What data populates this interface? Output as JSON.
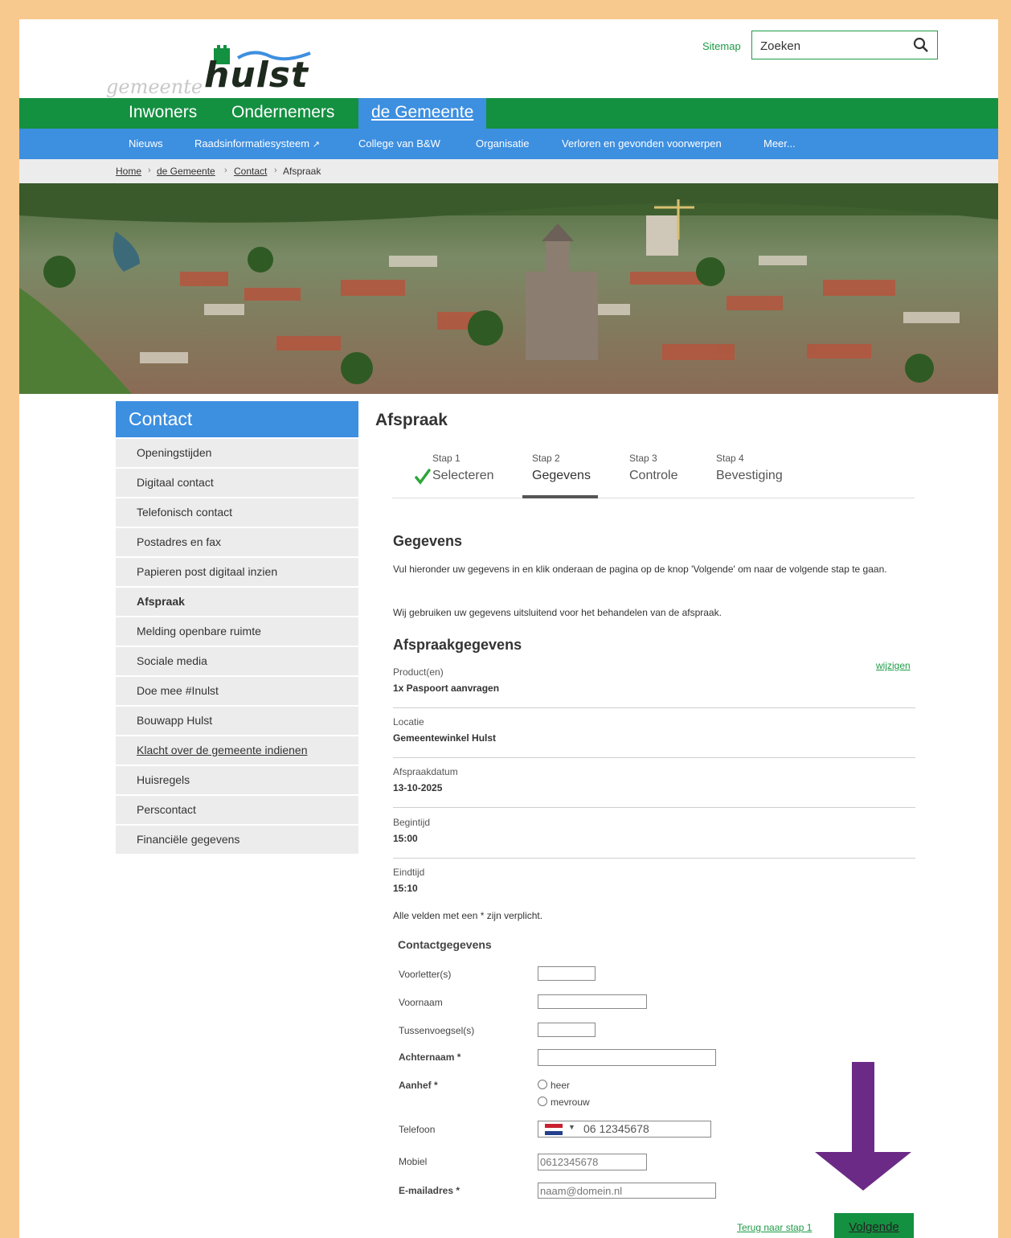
{
  "header": {
    "logo_prefix": "gemeente",
    "logo_name": "hulst",
    "sitemap_label": "Sitemap",
    "search_placeholder": "Zoeken"
  },
  "main_nav": [
    "Inwoners",
    "Ondernemers",
    "de Gemeente"
  ],
  "sub_nav": [
    "Nieuws",
    "Raadsinformatiesysteem",
    "College van B&W",
    "Organisatie",
    "Verloren en gevonden voorwerpen",
    "Meer..."
  ],
  "breadcrumb": [
    "Home",
    "de Gemeente",
    "Contact",
    "Afspraak"
  ],
  "banner_alt": "",
  "sidebar": {
    "title": "Contact",
    "items": [
      "Openingstijden",
      "Digitaal contact",
      "Telefonisch contact",
      "Postadres en fax",
      "Papieren post digitaal inzien",
      "Afspraak",
      "Melding openbare ruimte",
      "Sociale media",
      "Doe mee #Inulst",
      "Bouwapp Hulst",
      "Klacht over de gemeente indienen",
      "Huisregels",
      "Perscontact",
      "Financiële gegevens"
    ]
  },
  "page": {
    "title": "Afspraak",
    "steps": [
      {
        "num": "Stap 1",
        "label": "Selecteren"
      },
      {
        "num": "Stap 2",
        "label": "Gegevens"
      },
      {
        "num": "Stap 3",
        "label": "Controle"
      },
      {
        "num": "Stap 4",
        "label": "Bevestiging"
      }
    ],
    "section_title": "Gegevens",
    "intro_1": "Vul hieronder uw gegevens in en klik onderaan de pagina op de knop 'Volgende' om naar de volgende stap te gaan.",
    "intro_2": "Wij gebruiken uw gegevens uitsluitend voor het behandelen van de afspraak.",
    "appointment_title": "Afspraakgegevens",
    "change_link": "wijzigen",
    "fields": [
      {
        "label": "Product(en)",
        "value": "1x Paspoort aanvragen"
      },
      {
        "label": "Locatie",
        "value": "Gemeentewinkel Hulst"
      },
      {
        "label": "Afspraakdatum",
        "value": "13-10-2025"
      },
      {
        "label": "Begintijd",
        "value": "15:00"
      },
      {
        "label": "Eindtijd",
        "value": "15:10"
      }
    ],
    "required_note": "Alle velden met een * zijn verplicht.",
    "contact_title": "Contactgegevens",
    "form": {
      "voorletters": "Voorletter(s)",
      "voornaam": "Voornaam",
      "tussenvoegsel": "Tussenvoegsel(s)",
      "achternaam": "Achternaam *",
      "aanhef": "Aanhef *",
      "aanhef_options": [
        "heer",
        "mevrouw"
      ],
      "telefoon": "Telefoon",
      "telefoon_placeholder": "06 12345678",
      "mobiel": "Mobiel",
      "mobiel_placeholder": "0612345678",
      "email": "E-mailadres *",
      "email_placeholder": "naam@domein.nl"
    },
    "back_link": "Terug naar stap 1",
    "next_button": "Volgende"
  },
  "colors": {
    "green": "#149041",
    "blue": "#3d8fe0",
    "frame": "#f7c98e",
    "annotation_arrow": "#6b2a86"
  },
  "icons": [
    "search-icon",
    "checkmark-icon",
    "external-link-icon",
    "flag-nl-icon",
    "arrow-down-icon"
  ]
}
